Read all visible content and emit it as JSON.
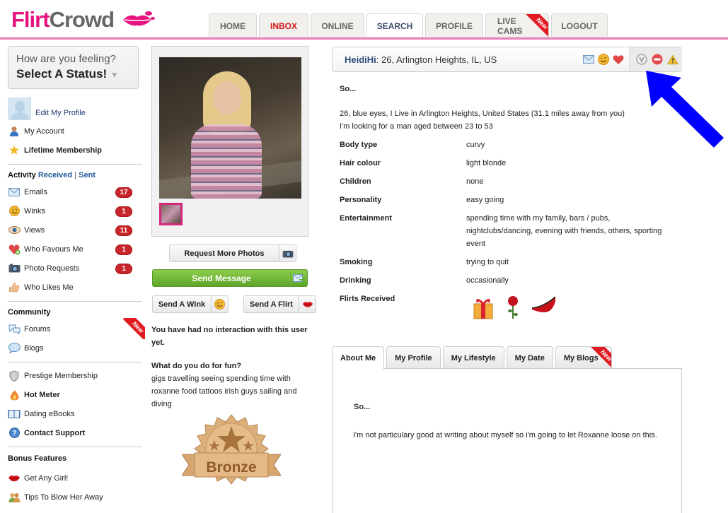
{
  "brand": {
    "part1": "Flirt",
    "part2": "Crowd",
    "pink": "#e5137f"
  },
  "nav": {
    "tabs": [
      {
        "label": "HOME"
      },
      {
        "label": "INBOX"
      },
      {
        "label": "ONLINE"
      },
      {
        "label": "SEARCH",
        "active": true
      },
      {
        "label": "PROFILE"
      },
      {
        "label": "LIVE CAMS",
        "ribbon": "New"
      },
      {
        "label": "LOGOUT"
      }
    ]
  },
  "sidebar": {
    "status_question": "How are you feeling?",
    "status_select": "Select A Status!",
    "edit_profile": "Edit My Profile",
    "my_account": "My Account",
    "lifetime": "Lifetime Membership",
    "activity": {
      "title": "Activity",
      "received": "Received",
      "sep": "|",
      "sent": "Sent"
    },
    "activity_items": [
      {
        "label": "Emails",
        "icon": "envelope-icon",
        "count": "17"
      },
      {
        "label": "Winks",
        "icon": "wink-smiley-icon",
        "count": "1"
      },
      {
        "label": "Views",
        "icon": "eye-icon",
        "count": "11"
      },
      {
        "label": "Who Favours Me",
        "icon": "heart-plus-icon",
        "count": "1"
      },
      {
        "label": "Photo Requests",
        "icon": "camera-icon",
        "count": "1"
      },
      {
        "label": "Who Likes Me",
        "icon": "thumbs-up-icon",
        "count": ""
      }
    ],
    "community_title": "Community",
    "community_items": [
      {
        "label": "Forums",
        "icon": "forums-icon",
        "ribbon": "New"
      },
      {
        "label": "Blogs",
        "icon": "speech-bubble-icon"
      }
    ],
    "extra_items": [
      {
        "label": "Prestige Membership",
        "icon": "shield-icon",
        "bold": false
      },
      {
        "label": "Hot Meter",
        "icon": "flame-icon",
        "bold": true
      },
      {
        "label": "Dating eBooks",
        "icon": "book-icon",
        "bold": false
      },
      {
        "label": "Contact Support",
        "icon": "help-icon",
        "bold": true
      }
    ],
    "bonus_title": "Bonus Features",
    "bonus_items": [
      {
        "label": "Get Any Girl!",
        "icon": "lips-icon"
      },
      {
        "label": "Tips To Blow Her Away",
        "icon": "couple-icon"
      }
    ]
  },
  "middle": {
    "request_photos": "Request More Photos",
    "send_message": "Send Message",
    "send_wink": "Send A Wink",
    "send_flirt": "Send A Flirt",
    "interaction": "You have had no interaction with this user yet.",
    "fun_question": "What do you do for fun?",
    "fun_answer": "gigs travelling seeing spending time with roxanne food tattoos irish guys sailing and diving",
    "badge_label": "Bronze"
  },
  "profile": {
    "username": "HeidiHi",
    "summary": ": 26, Arlington Heights, IL, US",
    "so": "So...",
    "bio_line1": "26, blue eyes, I Live in Arlington Heights, United States (31.1 miles away from you)",
    "bio_line2": "I'm looking for a man aged between 23 to 53",
    "attributes": [
      {
        "key": "Body type",
        "value": "curvy"
      },
      {
        "key": "Hair colour",
        "value": "light blonde"
      },
      {
        "key": "Children",
        "value": "none"
      },
      {
        "key": "Personality",
        "value": "easy going"
      },
      {
        "key": "Entertainment",
        "value": "spending time with my family, bars / pubs, nightclubs/dancing, evening with friends, others, sporting event"
      },
      {
        "key": "Smoking",
        "value": "trying to quit"
      },
      {
        "key": "Drinking",
        "value": "occasionally"
      }
    ],
    "flirts_label": "Flirts Received",
    "flirts": [
      "gift-icon",
      "rose-icon",
      "lingerie-icon"
    ]
  },
  "tabs": [
    {
      "label": "About Me",
      "active": true
    },
    {
      "label": "My Profile"
    },
    {
      "label": "My Lifestyle"
    },
    {
      "label": "My Date"
    },
    {
      "label": "My Blogs",
      "ribbon": "New"
    }
  ],
  "about": {
    "so": "So...",
    "text": "I'm not particulary good at writing about myself so i'm going to let Roxanne loose on this."
  },
  "annotation": {
    "arrow_color": "#0000ff"
  }
}
